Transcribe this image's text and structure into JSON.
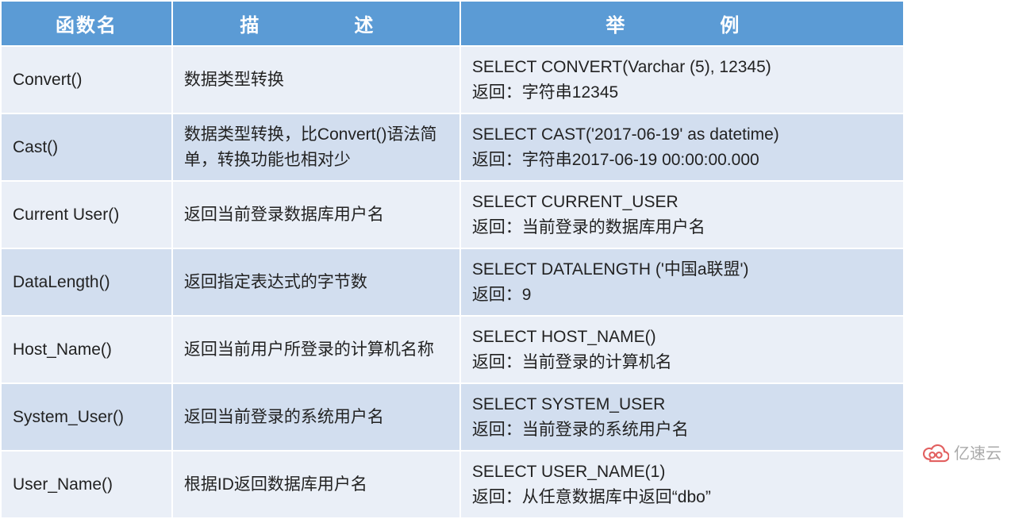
{
  "table": {
    "headers": [
      "函数名",
      "描　　述",
      "举　　例"
    ],
    "rows": [
      {
        "name": "Convert()",
        "desc": "数据类型转换",
        "example": "SELECT CONVERT(Varchar (5), 12345)\n返回：字符串12345"
      },
      {
        "name": "Cast()",
        "desc": "数据类型转换，比Convert()语法简单，转换功能也相对少",
        "example": "SELECT CAST('2017-06-19'   as datetime)\n返回：字符串2017-06-19 00:00:00.000"
      },
      {
        "name": "Current User()",
        "desc": "返回当前登录数据库用户名",
        "example": "SELECT CURRENT_USER\n返回：当前登录的数据库用户名"
      },
      {
        "name": "DataLength()",
        "desc": "返回指定表达式的字节数",
        "example": "SELECT DATALENGTH ('中国a联盟')\n返回：9"
      },
      {
        "name": "Host_Name()",
        "desc": "返回当前用户所登录的计算机名称",
        "example": "SELECT HOST_NAME()\n返回：当前登录的计算机名"
      },
      {
        "name": "System_User()",
        "desc": "返回当前登录的系统用户名",
        "example": "SELECT SYSTEM_USER\n返回：当前登录的系统用户名"
      },
      {
        "name": "User_Name()",
        "desc": "根据ID返回数据库用户名",
        "example": "SELECT USER_NAME(1)\n返回：从任意数据库中返回“dbo”"
      }
    ]
  },
  "watermark": "亿速云"
}
